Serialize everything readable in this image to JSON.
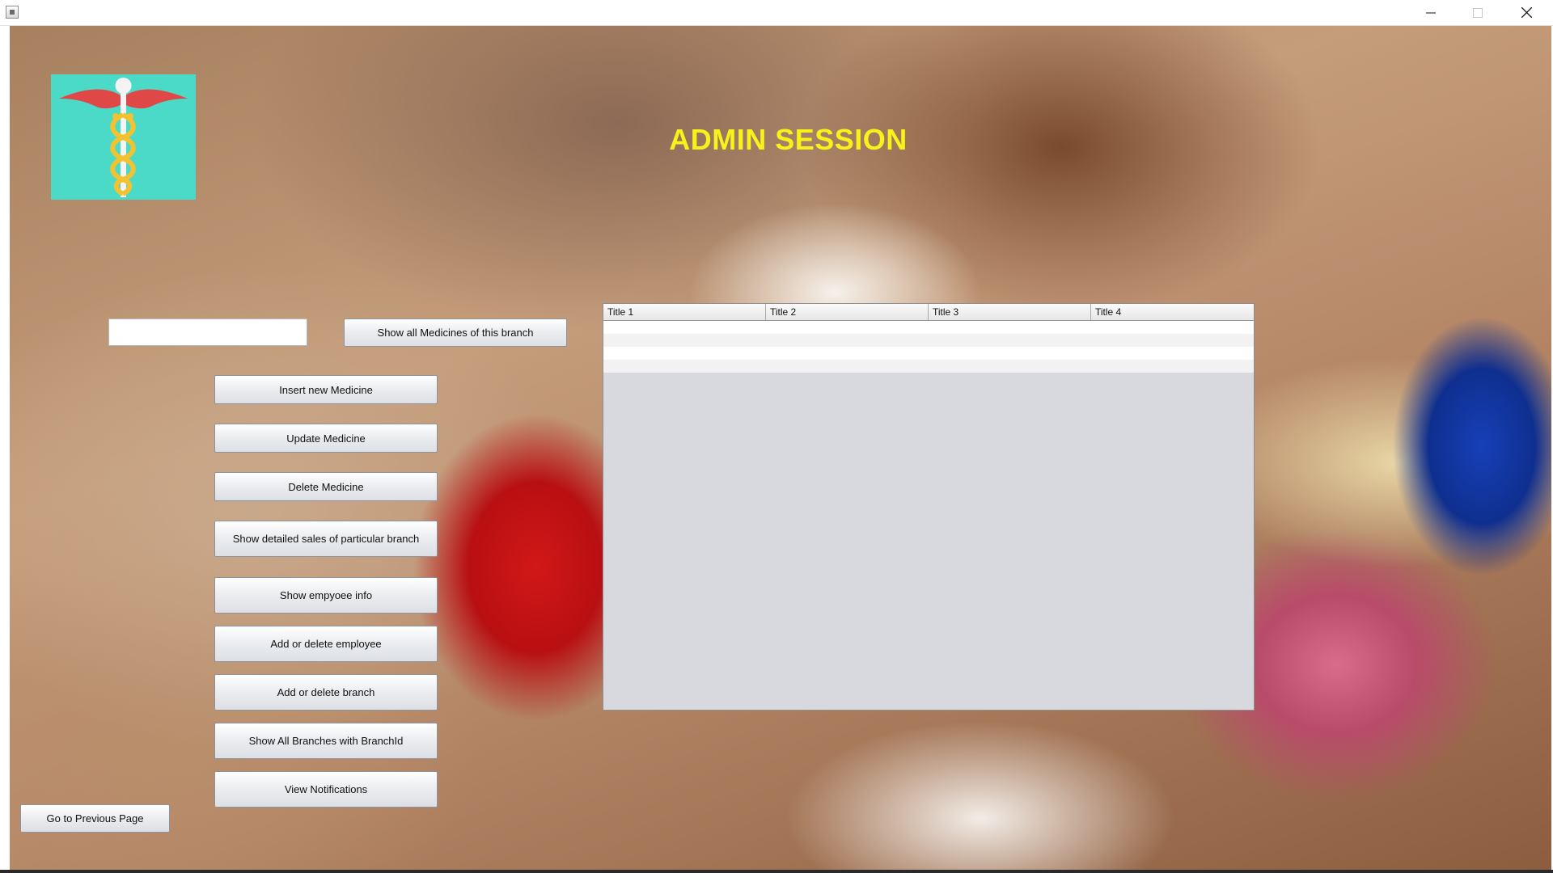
{
  "window": {
    "title": "",
    "icons": {
      "app": "java-app-icon",
      "minimize": "minimize-icon",
      "maximize": "maximize-icon",
      "close": "close-icon"
    }
  },
  "header": {
    "title": "ADMIN SESSION",
    "title_color": "#f7f21a",
    "logo": "caduceus-logo"
  },
  "search": {
    "value": "",
    "placeholder": ""
  },
  "actions": {
    "show_all_medicines": "Show all Medicines of this branch",
    "insert_medicine": "Insert new Medicine",
    "update_medicine": "Update Medicine",
    "delete_medicine": "Delete Medicine",
    "show_sales": "Show detailed sales of particular branch",
    "show_employee": "Show empyoee info",
    "add_delete_employee": "Add or delete employee",
    "add_delete_branch": "Add or delete branch",
    "show_branches": "Show All Branches with BranchId",
    "view_notifications": "View Notifications",
    "go_back": "Go to Previous Page"
  },
  "table": {
    "columns": [
      "Title 1",
      "Title 2",
      "Title 3",
      "Title 4"
    ],
    "rows": [
      [
        "",
        "",
        "",
        ""
      ],
      [
        "",
        "",
        "",
        ""
      ],
      [
        "",
        "",
        "",
        ""
      ],
      [
        "",
        "",
        "",
        ""
      ]
    ]
  },
  "colors": {
    "logo_background": "#4bdac7",
    "table_background": "#d7d9de"
  }
}
